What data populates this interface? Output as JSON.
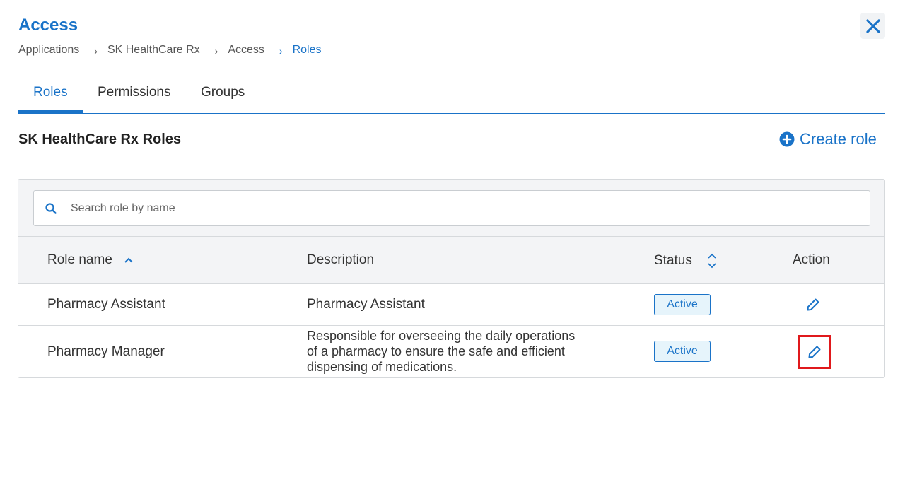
{
  "header": {
    "title": "Access",
    "close_icon": "close-icon"
  },
  "breadcrumb": {
    "items": [
      "Applications",
      "SK HealthCare Rx",
      "Access",
      "Roles"
    ],
    "separator": "›"
  },
  "tabs": [
    {
      "label": "Roles",
      "active": true
    },
    {
      "label": "Permissions",
      "active": false
    },
    {
      "label": "Groups",
      "active": false
    }
  ],
  "section": {
    "title": "SK HealthCare Rx Roles",
    "create_label": "Create role"
  },
  "search": {
    "placeholder": "Search role by name",
    "value": ""
  },
  "table": {
    "columns": {
      "role_name": "Role name",
      "description": "Description",
      "status": "Status",
      "action": "Action"
    },
    "rows": [
      {
        "name": "Pharmacy Assistant",
        "description_lines": [
          "Pharmacy Assistant"
        ],
        "status": "Active"
      },
      {
        "name": "Pharmacy Manager",
        "description_lines": [
          "Responsible for overseeing the daily operations",
          "of a pharmacy to ensure the safe and efficient",
          "dispensing of medications."
        ],
        "status": "Active"
      }
    ]
  },
  "colors": {
    "accent": "#1a73c8",
    "badge_bg": "#e6f4fb",
    "highlight": "#e0191c",
    "header_bg": "#f3f4f6"
  }
}
